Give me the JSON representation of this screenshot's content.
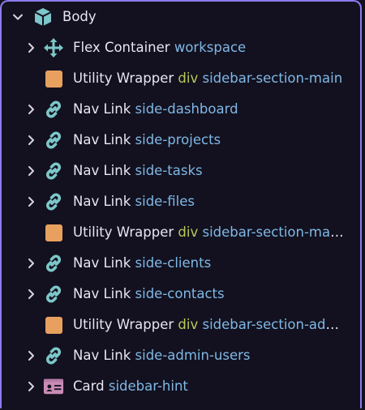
{
  "colors": {
    "accent_border": "#8b7cf0",
    "background": "#13111f",
    "teal_icon": "#7cc7c9",
    "orange_square": "#e8a05f",
    "card_icon": "#c98cb7",
    "class_text": "#7fb8e6",
    "tag_text": "#b7c95a"
  },
  "tree": {
    "root": {
      "label": "Body",
      "icon": "cube-icon",
      "expanded": true
    },
    "items": [
      {
        "icon": "move-arrows-icon",
        "expandable": true,
        "name": "Flex Container",
        "tag": "",
        "cls": "workspace"
      },
      {
        "icon": "orange-square-icon",
        "expandable": false,
        "name": "Utility Wrapper",
        "tag": "div",
        "cls": "sidebar-section-main"
      },
      {
        "icon": "link-icon",
        "expandable": true,
        "name": "Nav Link",
        "tag": "",
        "cls": "side-dashboard"
      },
      {
        "icon": "link-icon",
        "expandable": true,
        "name": "Nav Link",
        "tag": "",
        "cls": "side-projects"
      },
      {
        "icon": "link-icon",
        "expandable": true,
        "name": "Nav Link",
        "tag": "",
        "cls": "side-tasks"
      },
      {
        "icon": "link-icon",
        "expandable": true,
        "name": "Nav Link",
        "tag": "",
        "cls": "side-files"
      },
      {
        "icon": "orange-square-icon",
        "expandable": false,
        "name": "Utility Wrapper",
        "tag": "div",
        "cls": "sidebar-section-manage"
      },
      {
        "icon": "link-icon",
        "expandable": true,
        "name": "Nav Link",
        "tag": "",
        "cls": "side-clients"
      },
      {
        "icon": "link-icon",
        "expandable": true,
        "name": "Nav Link",
        "tag": "",
        "cls": "side-contacts"
      },
      {
        "icon": "orange-square-icon",
        "expandable": false,
        "name": "Utility Wrapper",
        "tag": "div",
        "cls": "sidebar-section-admin"
      },
      {
        "icon": "link-icon",
        "expandable": true,
        "name": "Nav Link",
        "tag": "",
        "cls": "side-admin-users"
      },
      {
        "icon": "id-card-icon",
        "expandable": true,
        "name": "Card",
        "tag": "",
        "cls": "sidebar-hint"
      }
    ]
  }
}
